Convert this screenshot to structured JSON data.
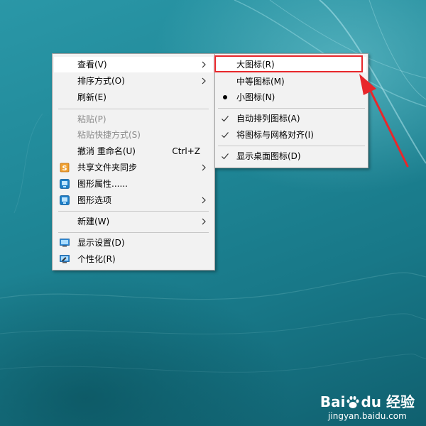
{
  "context_menu": {
    "items": [
      {
        "label": "查看(V)",
        "shortcut": "",
        "submenu": true,
        "disabled": false,
        "icon": ""
      },
      {
        "label": "排序方式(O)",
        "shortcut": "",
        "submenu": true,
        "disabled": false,
        "icon": ""
      },
      {
        "label": "刷新(E)",
        "shortcut": "",
        "submenu": false,
        "disabled": false,
        "icon": ""
      },
      {
        "label": "粘贴(P)",
        "shortcut": "",
        "submenu": false,
        "disabled": true,
        "icon": ""
      },
      {
        "label": "粘贴快捷方式(S)",
        "shortcut": "",
        "submenu": false,
        "disabled": true,
        "icon": ""
      },
      {
        "label": "撤消 重命名(U)",
        "shortcut": "Ctrl+Z",
        "submenu": false,
        "disabled": false,
        "icon": ""
      },
      {
        "label": "共享文件夹同步",
        "shortcut": "",
        "submenu": true,
        "disabled": false,
        "icon": "sync-folder-icon"
      },
      {
        "label": "图形属性......",
        "shortcut": "",
        "submenu": false,
        "disabled": false,
        "icon": "graphics-properties-icon"
      },
      {
        "label": "图形选项",
        "shortcut": "",
        "submenu": true,
        "disabled": false,
        "icon": "graphics-options-icon"
      },
      {
        "label": "新建(W)",
        "shortcut": "",
        "submenu": true,
        "disabled": false,
        "icon": ""
      },
      {
        "label": "显示设置(D)",
        "shortcut": "",
        "submenu": false,
        "disabled": false,
        "icon": "display-settings-icon"
      },
      {
        "label": "个性化(R)",
        "shortcut": "",
        "submenu": false,
        "disabled": false,
        "icon": "personalize-icon"
      }
    ]
  },
  "view_submenu": {
    "items": [
      {
        "label": "大图标(R)",
        "mark": "none",
        "highlighted": true
      },
      {
        "label": "中等图标(M)",
        "mark": "none",
        "highlighted": false
      },
      {
        "label": "小图标(N)",
        "mark": "dot",
        "highlighted": false
      },
      {
        "label": "自动排列图标(A)",
        "mark": "check",
        "highlighted": false
      },
      {
        "label": "将图标与网格对齐(I)",
        "mark": "check",
        "highlighted": false
      },
      {
        "label": "显示桌面图标(D)",
        "mark": "check",
        "highlighted": false
      }
    ]
  },
  "annotation": {
    "color": "#e8272b"
  },
  "watermark": {
    "brand_bai": "Bai",
    "brand_du": "du",
    "brand_jingyan": "经验",
    "url": "jingyan.baidu.com"
  },
  "colors": {
    "menu_bg": "#f2f2f2",
    "menu_border": "#a0a0a0",
    "disabled_text": "#8c8c8c",
    "desktop": "#1f8797"
  }
}
